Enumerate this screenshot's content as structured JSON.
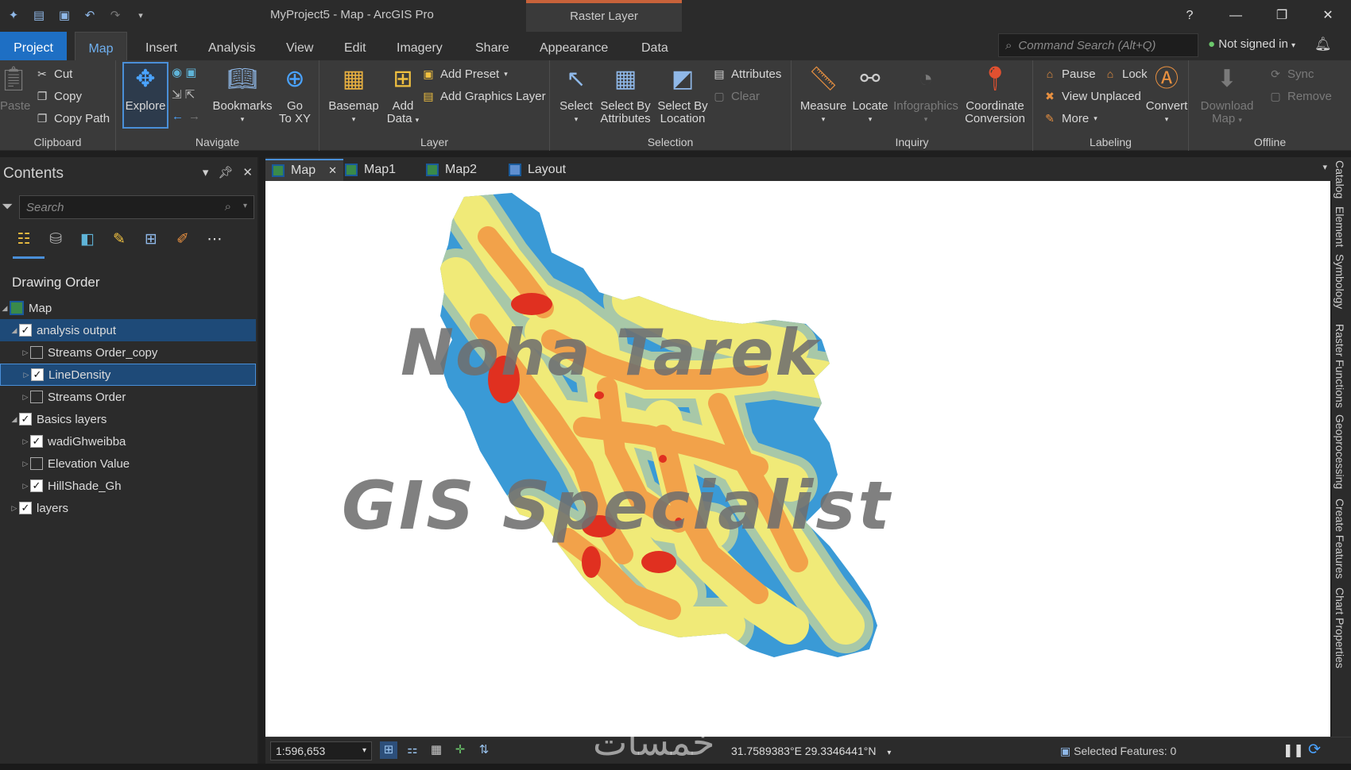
{
  "window": {
    "title": "MyProject5 - Map - ArcGIS Pro",
    "context_tab": "Raster Layer",
    "help": "?",
    "minimize": "—",
    "restore": "❐",
    "close": "✕"
  },
  "tabs": [
    "Project",
    "Map",
    "Insert",
    "Analysis",
    "View",
    "Edit",
    "Imagery",
    "Share",
    "Appearance",
    "Data"
  ],
  "command_search": {
    "placeholder": "Command Search (Alt+Q)"
  },
  "account": {
    "label": "Not signed in"
  },
  "ribbon": {
    "clipboard": {
      "group": "Clipboard",
      "paste": "Paste",
      "cut": "Cut",
      "copy": "Copy",
      "copy_path": "Copy Path"
    },
    "navigate": {
      "group": "Navigate",
      "explore": "Explore",
      "bookmarks": "Bookmarks",
      "go_to_xy_1": "Go",
      "go_to_xy_2": "To XY"
    },
    "layer": {
      "group": "Layer",
      "basemap": "Basemap",
      "add_data_1": "Add",
      "add_data_2": "Data",
      "add_preset": "Add Preset",
      "add_graphics_layer": "Add Graphics Layer"
    },
    "selection": {
      "group": "Selection",
      "select": "Select",
      "sba_1": "Select By",
      "sba_2": "Attributes",
      "sbl_1": "Select By",
      "sbl_2": "Location",
      "attributes": "Attributes",
      "clear": "Clear"
    },
    "inquiry": {
      "group": "Inquiry",
      "measure": "Measure",
      "locate": "Locate",
      "infographics": "Infographics",
      "coord_1": "Coordinate",
      "coord_2": "Conversion"
    },
    "labeling": {
      "group": "Labeling",
      "pause": "Pause",
      "lock": "Lock",
      "view_unplaced": "View Unplaced",
      "more": "More",
      "convert": "Convert"
    },
    "offline": {
      "group": "Offline",
      "download_1": "Download",
      "download_2": "Map",
      "sync": "Sync",
      "remove": "Remove"
    }
  },
  "contents": {
    "title": "Contents",
    "search_placeholder": "Search",
    "drawing_order": "Drawing Order",
    "tree": [
      {
        "label": "Map",
        "level": 0,
        "type": "map"
      },
      {
        "label": "analysis output",
        "level": 1,
        "checked": true,
        "selected": true
      },
      {
        "label": "Streams Order_copy",
        "level": 2,
        "checked": false
      },
      {
        "label": "LineDensity",
        "level": 2,
        "checked": true,
        "selected": true
      },
      {
        "label": "Streams Order",
        "level": 2,
        "checked": false
      },
      {
        "label": "Basics layers",
        "level": 1,
        "checked": true
      },
      {
        "label": "wadiGhweibba",
        "level": 2,
        "checked": true
      },
      {
        "label": "Elevation Value",
        "level": 2,
        "checked": false
      },
      {
        "label": "HillShade_Gh",
        "level": 2,
        "checked": true
      },
      {
        "label": "layers",
        "level": 1,
        "checked": true
      }
    ]
  },
  "view_tabs": [
    "Map",
    "Map1",
    "Map2",
    "Layout"
  ],
  "watermark": {
    "line1": "Noha Tarek",
    "line2": "GIS Specialist",
    "site": "خمسات"
  },
  "right_dock": [
    "Catalog",
    "Element",
    "Symbology",
    "Raster Functions",
    "Geoprocessing",
    "Create Features",
    "Chart Properties"
  ],
  "status": {
    "scale": "1:596,653",
    "coordinates": "31.7589383°E 29.3346441°N",
    "selected_features": "Selected Features: 0"
  },
  "colors": {
    "accent": "#1e6fc4",
    "density_low": "#3a9ad6",
    "density_mid_low": "#a8c8a8",
    "density_mid": "#f0ea78",
    "density_high": "#f2a24a",
    "density_max": "#e03020"
  }
}
